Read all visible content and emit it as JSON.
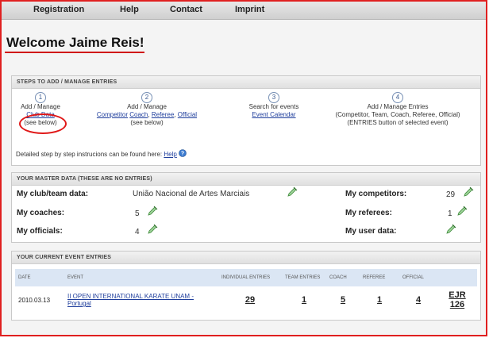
{
  "nav": {
    "registration": "Registration",
    "help": "Help",
    "contact": "Contact",
    "imprint": "Imprint"
  },
  "welcome": "Welcome Jaime Reis!",
  "steps": {
    "header": "STEPS TO ADD / MANAGE ENTRIES",
    "s1": {
      "num": "1",
      "line1": "Add / Manage",
      "link": "Club Data",
      "note": "(see below)"
    },
    "s2": {
      "num": "2",
      "line1": "Add / Manage",
      "link_competitor": "Competitor",
      "link_coach": "Coach",
      "link_referee": "Referee",
      "link_official": "Official",
      "note": "(see below)"
    },
    "s3": {
      "num": "3",
      "line1": "Search for events",
      "link": "Event Calendar"
    },
    "s4": {
      "num": "4",
      "line1": "Add / Manage Entries",
      "line2": "(Competitor, Team, Coach, Referee, Official)",
      "line3": "(ENTRIES button of selected event)"
    },
    "help_text": "Detailed step by step instrucions can be found here:",
    "help_link": "Help"
  },
  "master": {
    "header": "YOUR MASTER DATA (THESE ARE NO ENTRIES)",
    "club_label": "My club/team data:",
    "club_value": "União Nacional de Artes Marciais",
    "coaches_label": "My coaches:",
    "coaches_value": "5",
    "officials_label": "My officials:",
    "officials_value": "4",
    "competitors_label": "My competitors:",
    "competitors_value": "29",
    "referees_label": "My referees:",
    "referees_value": "1",
    "userdata_label": "My user data:"
  },
  "entries": {
    "header": "YOUR CURRENT EVENT ENTRIES",
    "columns": {
      "date": "DATE",
      "event": "EVENT",
      "individual": "INDIVIDUAL ENTRIES",
      "team": "TEAM ENTRIES",
      "coach": "COACH",
      "referee": "REFEREE",
      "official": "OFFICIAL"
    },
    "row": {
      "date": "2010.03.13",
      "event": "II OPEN INTERNATIONAL KARATE UNAM - Portugal",
      "individual": "29",
      "team": "1",
      "coach": "5",
      "referee": "1",
      "official": "4",
      "code": "EJR 126"
    }
  },
  "colors": {
    "accent_red": "#e01818",
    "link_blue": "#1f3e9c",
    "table_header": "#dbe6f4"
  }
}
